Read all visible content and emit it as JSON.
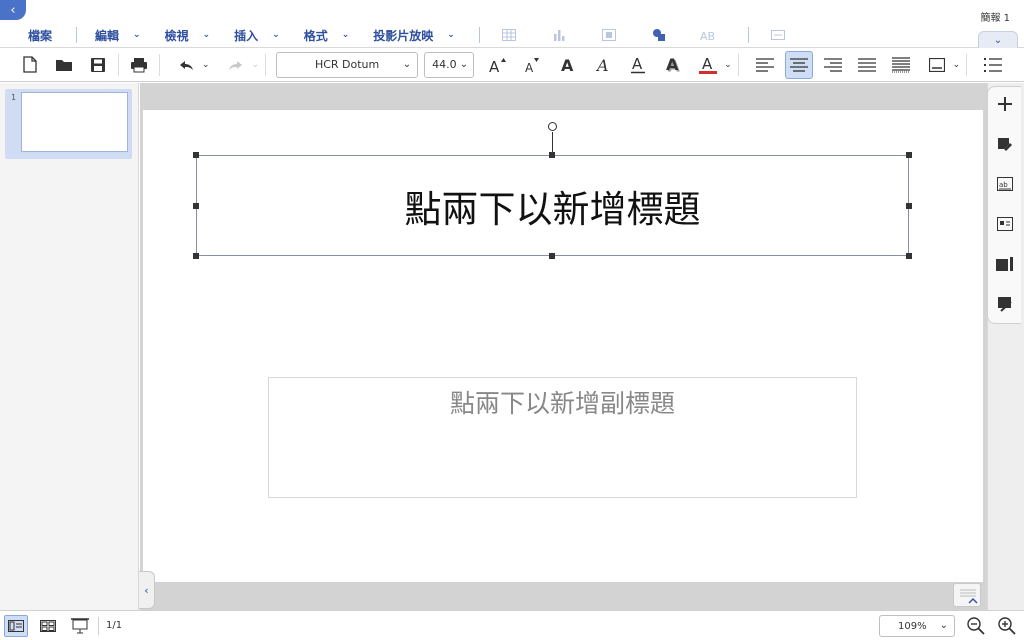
{
  "window": {
    "doc_title": "簡報 1"
  },
  "menu": {
    "items": [
      {
        "label": "檔案"
      },
      {
        "label": "編輯"
      },
      {
        "label": "檢視"
      },
      {
        "label": "插入"
      },
      {
        "label": "格式"
      },
      {
        "label": "投影片放映"
      }
    ]
  },
  "toolbar": {
    "font_name": "HCR Dotum",
    "font_size": "44.0"
  },
  "slides_panel": {
    "thumb_number": "1"
  },
  "slide": {
    "title_placeholder": "點兩下以新增標題",
    "subtitle_placeholder": "點兩下以新增副標題"
  },
  "status": {
    "page_count": "1/1",
    "zoom": "109%"
  },
  "colors": {
    "accent": "#2e4f9f",
    "back_tab": "#4a72c8",
    "font_color_underline": "#d32f2f",
    "active_button": "#cfddf5"
  }
}
